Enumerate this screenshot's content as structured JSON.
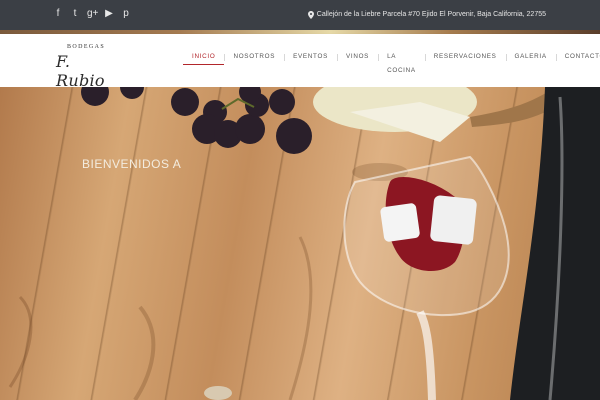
{
  "social": [
    {
      "icon": "facebook-icon",
      "glyph": "f"
    },
    {
      "icon": "twitter-icon",
      "glyph": "t"
    },
    {
      "icon": "google-plus-icon",
      "glyph": "g+"
    },
    {
      "icon": "youtube-icon",
      "glyph": "▶"
    },
    {
      "icon": "pinterest-icon",
      "glyph": "p"
    }
  ],
  "topbar": {
    "address": "Callejón de la Liebre Parcela #70 Ejido El Porvenir, Baja California, 22755"
  },
  "logo": {
    "top": "BODEGAS",
    "main": "F. Rubio"
  },
  "menu": [
    {
      "label": "INICIO",
      "active": true
    },
    {
      "label": "NOSOTROS",
      "active": false
    },
    {
      "label": "EVENTOS",
      "active": false
    },
    {
      "label": "VINOS",
      "active": false
    },
    {
      "label": "LA COCINA",
      "active": false
    },
    {
      "label": "RESERVACIONES",
      "active": false
    },
    {
      "label": "GALERIA",
      "active": false
    },
    {
      "label": "CONTACTO",
      "active": false
    }
  ],
  "hero": {
    "welcome": "BIENVENIDOS A"
  },
  "colors": {
    "topbar": "#3b3f45",
    "accent": "#b2262b",
    "nav_bg": "#ffffff",
    "wood": "#c89a68"
  }
}
